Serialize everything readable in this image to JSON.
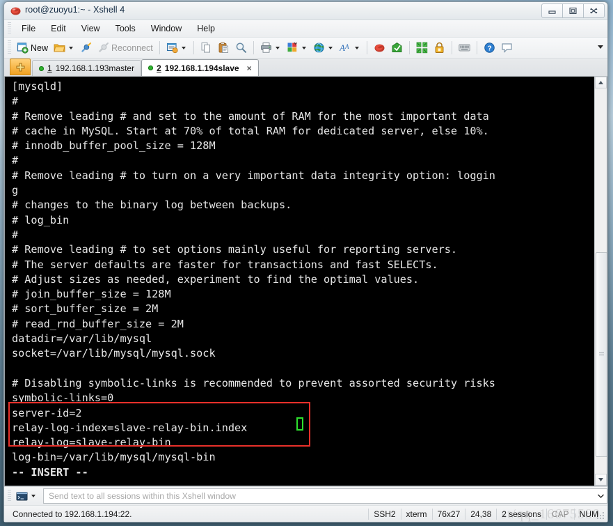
{
  "window": {
    "title": "root@zuoyu1:~ - Xshell 4",
    "app_icon": "xshell-icon",
    "buttons": {
      "minimize": "minimize-icon",
      "maximize": "maximize-icon",
      "close": "close-icon"
    }
  },
  "menubar": {
    "items": [
      {
        "label": "File"
      },
      {
        "label": "Edit"
      },
      {
        "label": "View"
      },
      {
        "label": "Tools"
      },
      {
        "label": "Window"
      },
      {
        "label": "Help"
      }
    ]
  },
  "toolbar": {
    "new_label": "New",
    "reconnect_label": "Reconnect",
    "items": [
      {
        "name": "new-session-button",
        "icon": "new-window-icon",
        "label": "New"
      },
      {
        "name": "open-session-button",
        "icon": "open-folder-icon",
        "label": ""
      },
      {
        "name": "connect-button",
        "icon": "plug-connect-icon",
        "label": ""
      },
      {
        "name": "reconnect-button",
        "icon": "plug-disconnect-icon",
        "label": "Reconnect"
      },
      {
        "name": "properties-button",
        "icon": "session-properties-icon",
        "label": ""
      },
      {
        "name": "copy-button",
        "icon": "copy-icon",
        "label": ""
      },
      {
        "name": "paste-button",
        "icon": "paste-icon",
        "label": ""
      },
      {
        "name": "find-button",
        "icon": "magnifier-icon",
        "label": ""
      },
      {
        "name": "print-button",
        "icon": "printer-icon",
        "label": ""
      },
      {
        "name": "layout-button",
        "icon": "color-blocks-icon",
        "label": ""
      },
      {
        "name": "web-button",
        "icon": "globe-icon",
        "label": ""
      },
      {
        "name": "font-button",
        "icon": "font-a-icon",
        "label": ""
      },
      {
        "name": "xshell-button",
        "icon": "xshell-logo-icon",
        "label": ""
      },
      {
        "name": "xftp-button",
        "icon": "xftp-icon",
        "label": ""
      },
      {
        "name": "fullscreen-button",
        "icon": "fullscreen-icon",
        "label": ""
      },
      {
        "name": "lock-button",
        "icon": "lock-icon",
        "label": ""
      },
      {
        "name": "keyboard-button",
        "icon": "keyboard-icon",
        "label": ""
      },
      {
        "name": "help-button",
        "icon": "help-question-icon",
        "label": ""
      },
      {
        "name": "chat-button",
        "icon": "speech-bubble-icon",
        "label": ""
      }
    ]
  },
  "tabs": {
    "new_tab_icon": "plus-tab-icon",
    "items": [
      {
        "num": "1",
        "label": "192.168.1.193master",
        "active": false,
        "status": "connected"
      },
      {
        "num": "2",
        "label": "192.168.1.194slave",
        "active": true,
        "status": "connected",
        "close": "×"
      }
    ]
  },
  "terminal": {
    "lines": [
      "[mysqld]",
      "#",
      "# Remove leading # and set to the amount of RAM for the most important data",
      "# cache in MySQL. Start at 70% of total RAM for dedicated server, else 10%.",
      "# innodb_buffer_pool_size = 128M",
      "#",
      "# Remove leading # to turn on a very important data integrity option: loggin",
      "g",
      "# changes to the binary log between backups.",
      "# log_bin",
      "#",
      "# Remove leading # to set options mainly useful for reporting servers.",
      "# The server defaults are faster for transactions and fast SELECTs.",
      "# Adjust sizes as needed, experiment to find the optimal values.",
      "# join_buffer_size = 128M",
      "# sort_buffer_size = 2M",
      "# read_rnd_buffer_size = 2M",
      "datadir=/var/lib/mysql",
      "socket=/var/lib/mysql/mysql.sock",
      "",
      "# Disabling symbolic-links is recommended to prevent assorted security risks",
      "symbolic-links=0",
      "server-id=2",
      "relay-log-index=slave-relay-bin.index",
      "relay-log=slave-relay-bin",
      "log-bin=/var/lib/mysql/mysql-bin"
    ],
    "mode_line": "-- INSERT --",
    "highlight_box_color": "#e8302a",
    "cursor_color": "#2ee02e",
    "background": "#000000",
    "foreground": "#e6e6e6"
  },
  "send_bar": {
    "mode_icon": "terminal-window-icon",
    "placeholder": "Send text to all sessions within this Xshell window",
    "value": ""
  },
  "statusbar": {
    "connection": "Connected to 192.168.1.194:22.",
    "cells": [
      {
        "name": "protocol",
        "text": "SSH2"
      },
      {
        "name": "terminal-type",
        "text": "xterm"
      },
      {
        "name": "terminal-size",
        "text": "76x27"
      },
      {
        "name": "cursor-position",
        "text": "24,38"
      },
      {
        "name": "session-count",
        "text": "2 sessions"
      },
      {
        "name": "caps-lock",
        "text": "CAP"
      },
      {
        "name": "num-lock",
        "text": "NUM"
      }
    ],
    "watermark": "st/qq_16675589"
  }
}
